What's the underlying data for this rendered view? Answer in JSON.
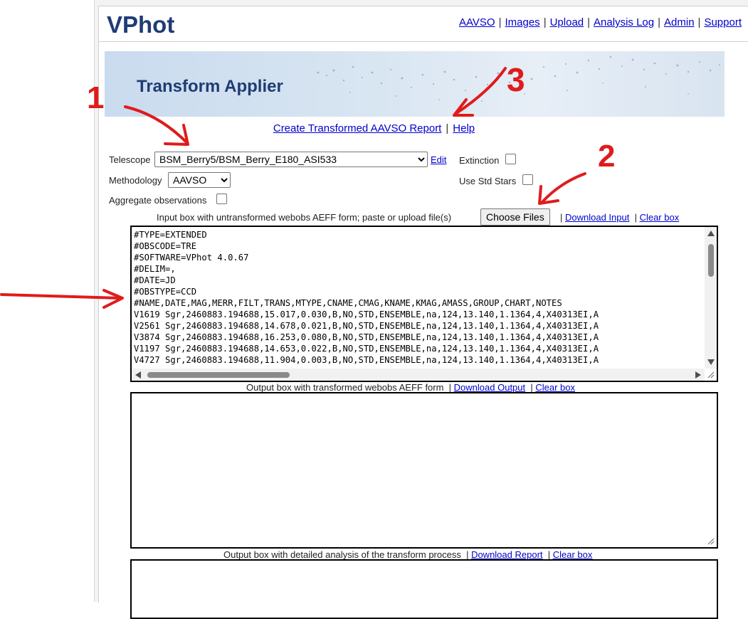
{
  "app": {
    "logo": "VPhot"
  },
  "topnav": {
    "items": [
      "AAVSO",
      "Images",
      "Upload",
      "Analysis Log",
      "Admin",
      "Support"
    ]
  },
  "banner": {
    "title": "Transform Applier"
  },
  "center_links": {
    "create_report": "Create Transformed AAVSO Report",
    "help": "Help"
  },
  "form": {
    "telescope_label": "Telescope",
    "telescope_value": "BSM_Berry5/BSM_Berry_E180_ASI533",
    "edit_link": "Edit",
    "methodology_label": "Methodology",
    "methodology_value": "AAVSO",
    "aggregate_label": "Aggregate observations",
    "extinction_label": "Extinction",
    "use_std_stars_label": "Use Std Stars"
  },
  "input_bar": {
    "label": "Input box with untransformed webobs AEFF form; paste or upload file(s)",
    "choose_files": "Choose Files",
    "download": "Download Input",
    "clear": "Clear box"
  },
  "input_box": {
    "lines": [
      "#TYPE=EXTENDED",
      "#OBSCODE=TRE",
      "#SOFTWARE=VPhot 4.0.67",
      "#DELIM=,",
      "#DATE=JD",
      "#OBSTYPE=CCD",
      "#NAME,DATE,MAG,MERR,FILT,TRANS,MTYPE,CNAME,CMAG,KNAME,KMAG,AMASS,GROUP,CHART,NOTES",
      "V1619 Sgr,2460883.194688,15.017,0.030,B,NO,STD,ENSEMBLE,na,124,13.140,1.1364,4,X40313EI,A",
      "V2561 Sgr,2460883.194688,14.678,0.021,B,NO,STD,ENSEMBLE,na,124,13.140,1.1364,4,X40313EI,A",
      "V3874 Sgr,2460883.194688,16.253,0.080,B,NO,STD,ENSEMBLE,na,124,13.140,1.1364,4,X40313EI,A",
      "V1197 Sgr,2460883.194688,14.653,0.022,B,NO,STD,ENSEMBLE,na,124,13.140,1.1364,4,X40313EI,A",
      "V4727 Sgr,2460883.194688,11.904,0.003,B,NO,STD,ENSEMBLE,na,124,13.140,1.1364,4,X40313EI,A"
    ]
  },
  "output_bar": {
    "label": "Output box with transformed webobs AEFF form",
    "download": "Download Output",
    "clear": "Clear box"
  },
  "report_bar": {
    "label": "Output box with detailed analysis of the transform process",
    "download": "Download Report",
    "clear": "Clear box"
  },
  "annotations": {
    "n1": "1",
    "n2": "2",
    "n3": "3"
  },
  "colors": {
    "link": "#0000cc",
    "logo": "#1f3c73",
    "annotation": "#e01b1b"
  }
}
